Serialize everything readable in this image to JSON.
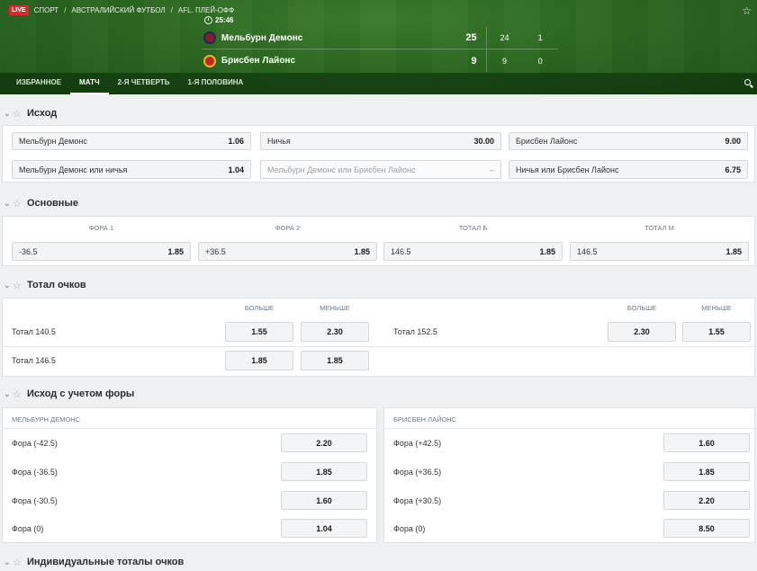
{
  "header": {
    "live_badge": "LIVE",
    "breadcrumb": [
      "СПОРТ",
      "АВСТРАЛИЙСКИЙ ФУТБОЛ",
      "AFL. ПЛЕЙ-ОФФ"
    ],
    "breadcrumb_sep": "/",
    "match_time": "25:46",
    "teams": [
      {
        "name": "Мельбурн Демонс",
        "score": "25",
        "q1": "24",
        "q2": "1"
      },
      {
        "name": "Брисбен Лайонс",
        "score": "9",
        "q1": "9",
        "q2": "0"
      }
    ]
  },
  "tabs": [
    "ИЗБРАННОЕ",
    "МАТЧ",
    "2-Я ЧЕТВЕРТЬ",
    "1-Я ПОЛОВИНА"
  ],
  "active_tab": "МАТЧ",
  "sections": {
    "outcome": {
      "title": "Исход",
      "markets": [
        {
          "label": "Мельбурн Демонс",
          "odd": "1.06"
        },
        {
          "label": "Ничья",
          "odd": "30.00"
        },
        {
          "label": "Брисбен Лайонс",
          "odd": "9.00"
        },
        {
          "label": "Мельбурн Демонс или ничья",
          "odd": "1.04"
        },
        {
          "label": "Мельбурн Демонс или Брисбен Лайонс",
          "odd": "–"
        },
        {
          "label": "Ничья или Брисбен Лайонс",
          "odd": "6.75"
        }
      ]
    },
    "main": {
      "title": "Основные",
      "columns": [
        "ФОРА 1",
        "ФОРА 2",
        "ТОТАЛ Б",
        "ТОТАЛ М"
      ],
      "markets": [
        {
          "label": "-36.5",
          "odd": "1.85"
        },
        {
          "label": "+36.5",
          "odd": "1.85"
        },
        {
          "label": "146.5",
          "odd": "1.85"
        },
        {
          "label": "146.5",
          "odd": "1.85"
        }
      ]
    },
    "total": {
      "title": "Тотал очков",
      "col_over": "БОЛЬШЕ",
      "col_under": "МЕНЬШЕ",
      "left": [
        {
          "label": "Тотал 140.5",
          "over": "1.55",
          "under": "2.30"
        },
        {
          "label": "Тотал 146.5",
          "over": "1.85",
          "under": "1.85"
        }
      ],
      "right": [
        {
          "label": "Тотал 152.5",
          "over": "2.30",
          "under": "1.55"
        }
      ]
    },
    "handicap": {
      "title": "Исход с учетом форы",
      "left_team": "МЕЛЬБУРН ДЕМОНС",
      "right_team": "БРИСБЕН ЛАЙОНС",
      "left": [
        {
          "label": "Фора (-42.5)",
          "odd": "2.20"
        },
        {
          "label": "Фора (-36.5)",
          "odd": "1.85"
        },
        {
          "label": "Фора (-30.5)",
          "odd": "1.60"
        },
        {
          "label": "Фора (0)",
          "odd": "1.04"
        }
      ],
      "right": [
        {
          "label": "Фора (+42.5)",
          "odd": "1.60"
        },
        {
          "label": "Фора (+36.5)",
          "odd": "1.85"
        },
        {
          "label": "Фора (+30.5)",
          "odd": "2.20"
        },
        {
          "label": "Фора (0)",
          "odd": "8.50"
        }
      ]
    },
    "individual": {
      "title": "Индивидуальные тоталы очков"
    }
  },
  "colors": {
    "live": "#d92b2b",
    "hero_green": "#2d6a22"
  }
}
